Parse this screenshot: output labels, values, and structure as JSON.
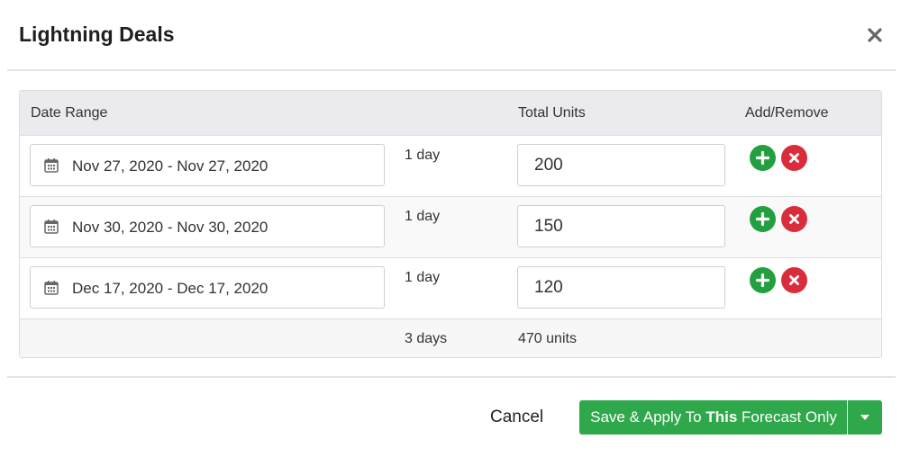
{
  "dialog": {
    "title": "Lightning Deals",
    "close_icon": "close-icon"
  },
  "table": {
    "headers": {
      "date_range": "Date Range",
      "days": "",
      "total_units": "Total Units",
      "add_remove": "Add/Remove"
    },
    "rows": [
      {
        "date_range": "Nov 27, 2020 - Nov 27, 2020",
        "days": "1 day",
        "units": "200"
      },
      {
        "date_range": "Nov 30, 2020 - Nov 30, 2020",
        "days": "1 day",
        "units": "150"
      },
      {
        "date_range": "Dec 17, 2020 - Dec 17, 2020",
        "days": "1 day",
        "units": "120"
      }
    ],
    "totals": {
      "days": "3 days",
      "units": "470 units"
    },
    "icons": {
      "date": "calendar-icon",
      "add": "plus-icon",
      "remove": "x-icon"
    }
  },
  "footer": {
    "cancel_label": "Cancel",
    "save_label_prefix": "Save & Apply To ",
    "save_label_bold": "This",
    "save_label_suffix": " Forecast Only",
    "dropdown_icon": "caret-down-icon"
  },
  "colors": {
    "primary_green": "#2ea84a",
    "add_green": "#22a03f",
    "remove_red": "#d92d3b",
    "header_bg": "#ebebef"
  }
}
